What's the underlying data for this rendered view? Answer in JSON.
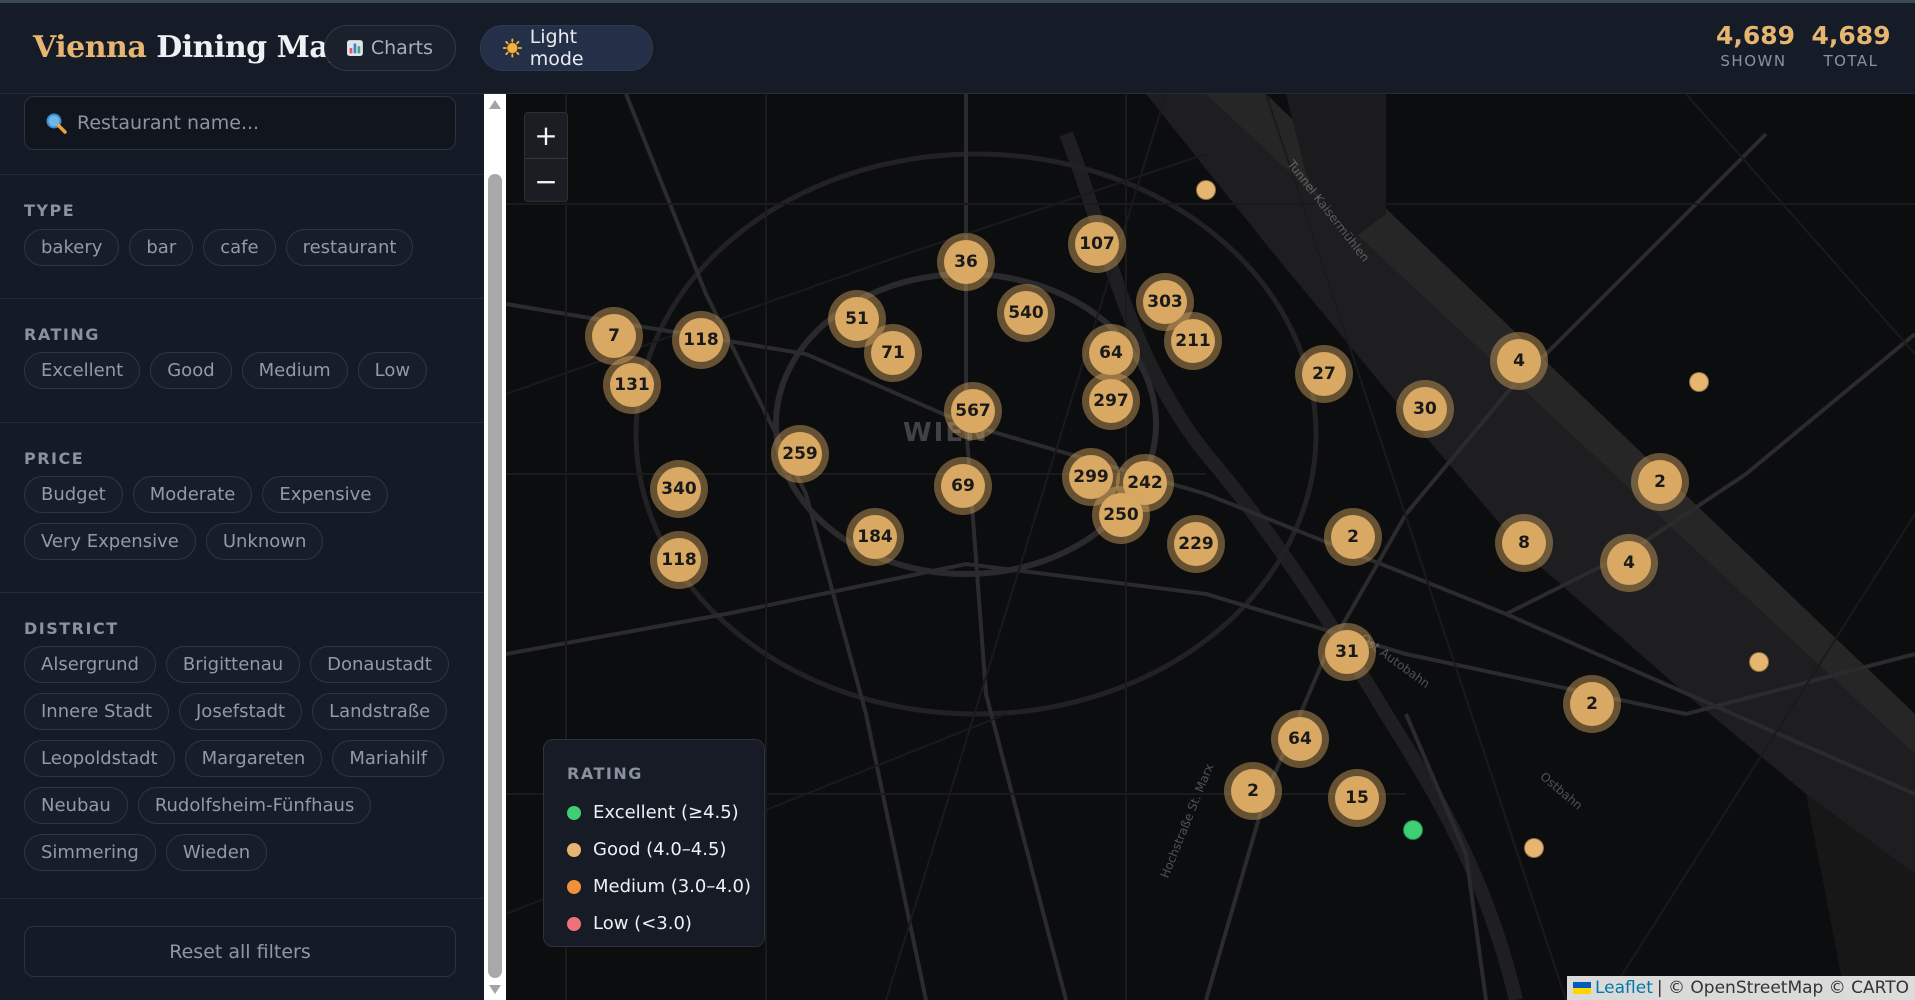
{
  "header": {
    "title_part1": "Vienna",
    "title_part2": "Dining Map",
    "charts_label": "Charts",
    "charts_icon": "bar-chart-icon",
    "theme_label": "Light mode",
    "theme_icon": "sun-icon",
    "shown_count": "4,689",
    "shown_label": "SHOWN",
    "total_count": "4,689",
    "total_label": "TOTAL"
  },
  "sidebar": {
    "search_placeholder": "Restaurant name...",
    "type": {
      "title": "TYPE",
      "options": [
        "bakery",
        "bar",
        "cafe",
        "restaurant"
      ]
    },
    "rating": {
      "title": "RATING",
      "options": [
        "Excellent",
        "Good",
        "Medium",
        "Low"
      ]
    },
    "price": {
      "title": "PRICE",
      "options": [
        "Budget",
        "Moderate",
        "Expensive",
        "Very Expensive",
        "Unknown"
      ]
    },
    "district": {
      "title": "DISTRICT",
      "options": [
        "Alsergrund",
        "Brigittenau",
        "Donaustadt",
        "Innere Stadt",
        "Josefstadt",
        "Landstraße",
        "Leopoldstadt",
        "Margareten",
        "Mariahilf",
        "Neubau",
        "Rudolfsheim-Fünfhaus",
        "Simmering",
        "Wieden"
      ]
    },
    "reset_label": "Reset all filters"
  },
  "map": {
    "zoom_in": "+",
    "zoom_out": "−",
    "city_label": "WIEN",
    "street_labels": [
      "Tunnel Kaisermühlen",
      "Ost Autobahn",
      "Ostbahn",
      "Hochstraße St. Marx"
    ],
    "clusters": [
      "107",
      "36",
      "540",
      "303",
      "211",
      "51",
      "7",
      "118",
      "71",
      "64",
      "27",
      "4",
      "131",
      "567",
      "297",
      "30",
      "259",
      "299",
      "242",
      "2",
      "340",
      "69",
      "250",
      "229",
      "2",
      "8",
      "184",
      "4",
      "118",
      "31",
      "2",
      "64",
      "2",
      "15"
    ],
    "legend": {
      "title": "RATING",
      "items": [
        {
          "label": "Excellent (≥4.5)",
          "color": "#3ecf74"
        },
        {
          "label": "Good (4.0–4.5)",
          "color": "#e6b670"
        },
        {
          "label": "Medium (3.0–4.0)",
          "color": "#f0903a"
        },
        {
          "label": "Low (<3.0)",
          "color": "#f07178"
        }
      ]
    },
    "attribution": {
      "leaflet": "Leaflet",
      "rest": "| © OpenStreetMap © CARTO"
    }
  }
}
